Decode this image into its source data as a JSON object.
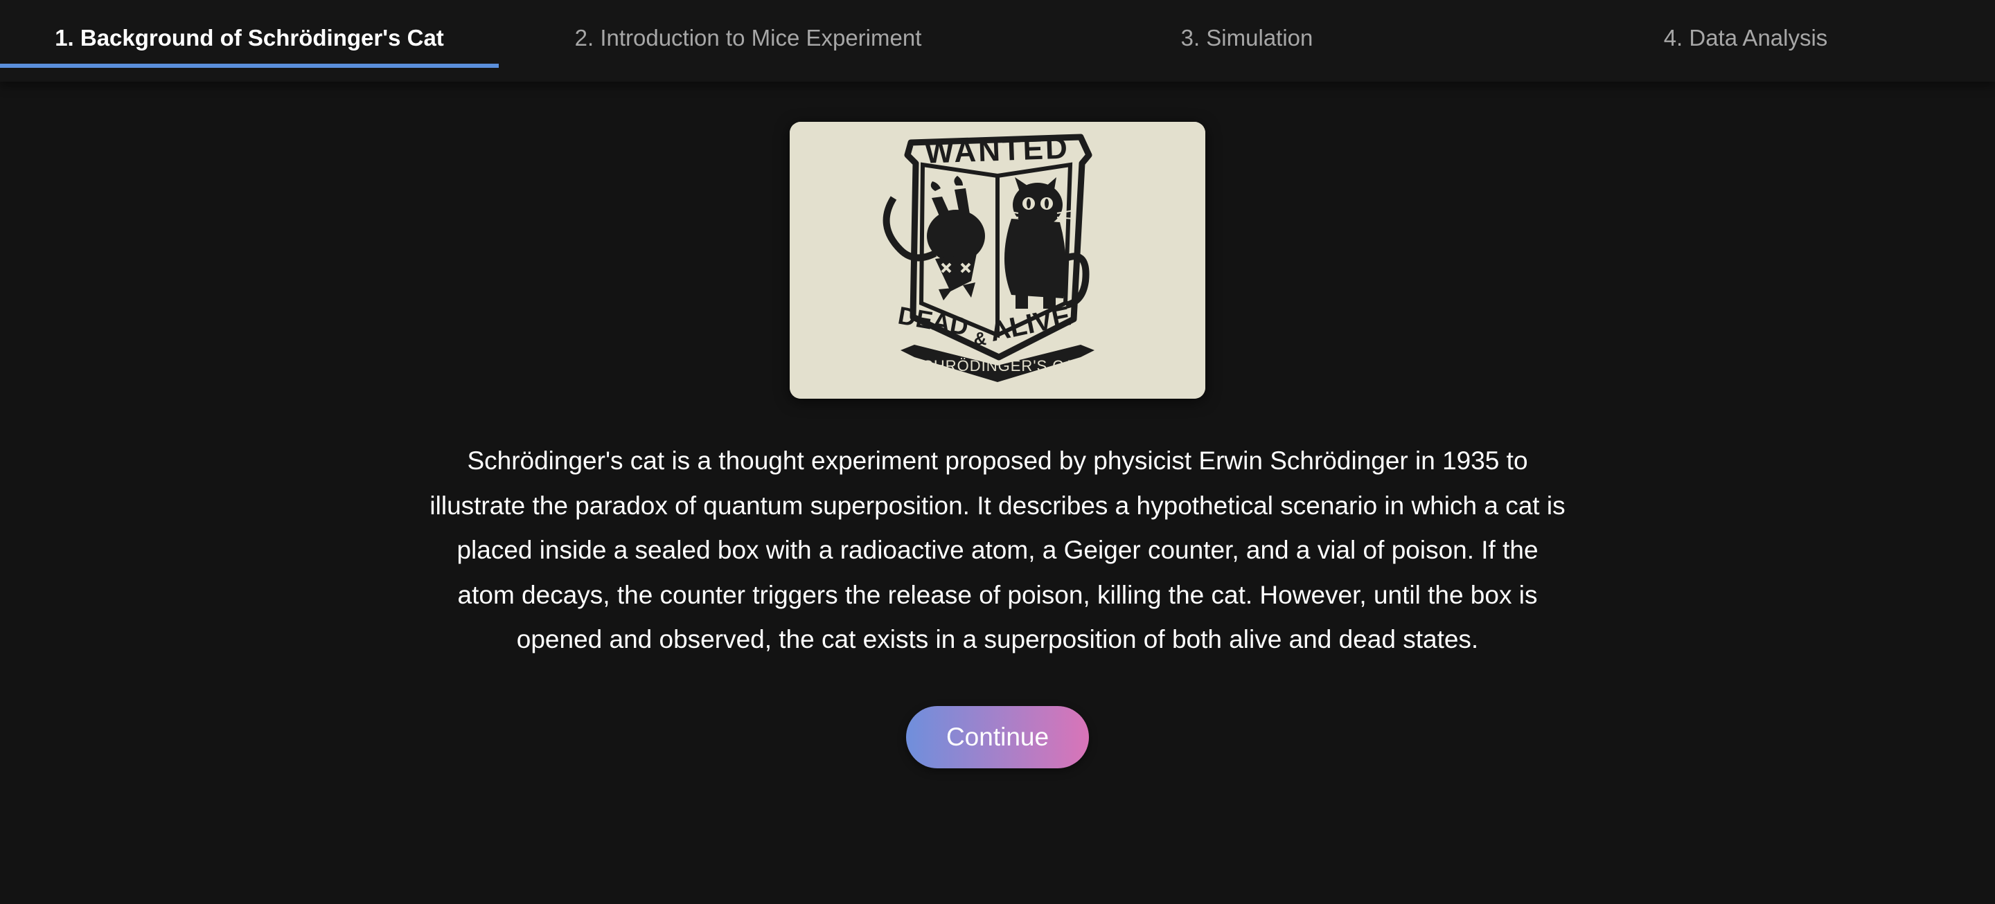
{
  "tabs": [
    {
      "label": "1. Background of Schrödinger's Cat",
      "active": true
    },
    {
      "label": "2. Introduction to Mice Experiment",
      "active": false
    },
    {
      "label": "3. Simulation",
      "active": false
    },
    {
      "label": "4. Data Analysis",
      "active": false
    }
  ],
  "hero_image": {
    "top_text": "WANTED",
    "mid_text_left": "DEAD",
    "mid_text_amp": "&",
    "mid_text_right": "ALIVE",
    "banner_text": "SCHRÖDINGER'S CAT",
    "background": "#e3e0ce",
    "ink": "#1c1c1c"
  },
  "description": "Schrödinger's cat is a thought experiment proposed by physicist Erwin Schrödinger in 1935 to illustrate the paradox of quantum superposition. It describes a hypothetical scenario in which a cat is placed inside a sealed box with a radioactive atom, a Geiger counter, and a vial of poison. If the atom decays, the counter triggers the release of poison, killing the cat. However, until the box is opened and observed, the cat exists in a superposition of both alive and dead states.",
  "continue_button": {
    "label": "Continue"
  },
  "colors": {
    "accent_tab_underline": "#5b8fdb",
    "button_gradient_start": "#6f8fdc",
    "button_gradient_end": "#d974b8",
    "page_background": "#131313"
  }
}
